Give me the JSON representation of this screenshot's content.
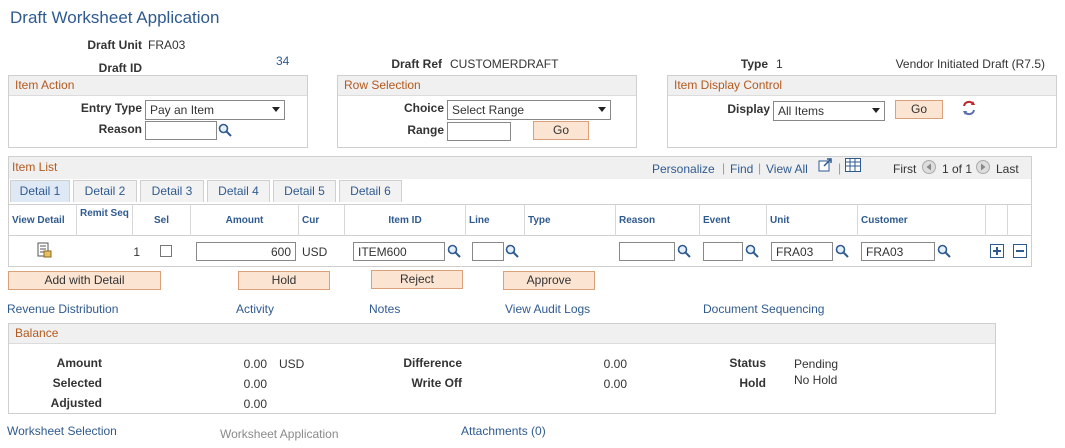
{
  "page_title": "Draft Worksheet Application",
  "header": {
    "draft_unit_label": "Draft Unit",
    "draft_unit": "FRA03",
    "draft_id_label": "Draft ID",
    "draft_id": "34",
    "draft_ref_label": "Draft Ref",
    "draft_ref": "CUSTOMERDRAFT",
    "type_label": "Type",
    "type_value": "1",
    "type_desc": "Vendor Initiated Draft (R7.5)"
  },
  "item_action": {
    "title": "Item Action",
    "entry_type_label": "Entry Type",
    "entry_type": "Pay an Item",
    "reason_label": "Reason",
    "reason_value": ""
  },
  "row_selection": {
    "title": "Row Selection",
    "choice_label": "Choice",
    "choice": "Select Range",
    "range_label": "Range",
    "range_value": "",
    "go_label": "Go"
  },
  "display_control": {
    "title": "Item Display Control",
    "display_label": "Display",
    "display": "All Items",
    "go_label": "Go"
  },
  "item_list": {
    "title": "Item List",
    "personalize": "Personalize",
    "find": "Find",
    "view_all": "View All",
    "first": "First",
    "count": "1 of 1",
    "last": "Last",
    "tabs": [
      "Detail 1",
      "Detail 2",
      "Detail 3",
      "Detail 4",
      "Detail 5",
      "Detail 6"
    ],
    "columns": {
      "view_detail": "View Detail",
      "remit_seq": "Remit Seq",
      "sel": "Sel",
      "amount": "Amount",
      "cur": "Cur",
      "item_id": "Item ID",
      "line": "Line",
      "type": "Type",
      "reason": "Reason",
      "event": "Event",
      "unit": "Unit",
      "customer": "Customer"
    },
    "row": {
      "remit_seq": "1",
      "amount": "600",
      "cur": "USD",
      "item_id": "ITEM600",
      "line": "",
      "reason": "",
      "event": "",
      "unit": "FRA03",
      "customer": "FRA03"
    }
  },
  "actions": {
    "add_with_detail": "Add with Detail",
    "hold": "Hold",
    "reject": "Reject",
    "approve": "Approve"
  },
  "links": {
    "revenue_distribution": "Revenue Distribution",
    "activity": "Activity",
    "notes": "Notes",
    "view_audit_logs": "View Audit Logs",
    "document_sequencing": "Document Sequencing"
  },
  "balance": {
    "title": "Balance",
    "amount_label": "Amount",
    "amount": "0.00",
    "amount_cur": "USD",
    "selected_label": "Selected",
    "selected": "0.00",
    "adjusted_label": "Adjusted",
    "adjusted": "0.00",
    "difference_label": "Difference",
    "difference": "0.00",
    "write_off_label": "Write Off",
    "write_off": "0.00",
    "status_label": "Status",
    "status": "Pending",
    "hold_label": "Hold",
    "hold": "No Hold"
  },
  "footer": {
    "worksheet_selection": "Worksheet Selection",
    "worksheet_application": "Worksheet Application",
    "attachments": "Attachments (0)"
  },
  "colors": {
    "link": "#2f5a8f",
    "group_title": "#b35a1f",
    "button_bg": "#fbe4d1"
  }
}
